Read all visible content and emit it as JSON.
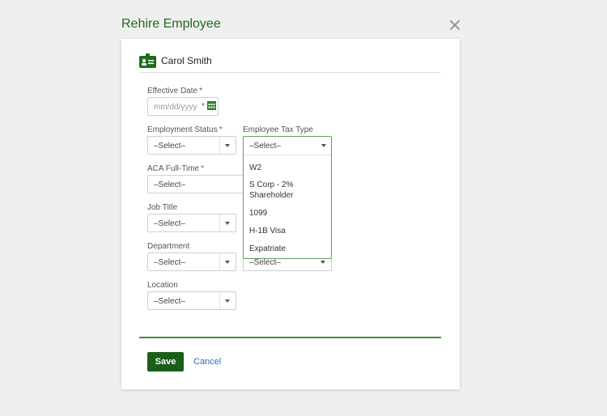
{
  "dialog": {
    "title": "Rehire Employee",
    "close_icon": "close-icon"
  },
  "employee": {
    "name": "Carol Smith",
    "icon": "id-badge-icon"
  },
  "form": {
    "required_mark": "*",
    "effective_date": {
      "label": "Effective Date",
      "placeholder": "mm/dd/yyyy",
      "icon": "calendar-icon"
    },
    "employment_status": {
      "label": "Employment Status",
      "value": "–Select–"
    },
    "employee_tax_type": {
      "label": "Employee Tax Type",
      "value": "–Select–",
      "options": [
        "W2",
        "S Corp - 2% Shareholder",
        "1099",
        "H-1B Visa",
        "Expatriate"
      ]
    },
    "aca_full_time": {
      "label": "ACA Full-Time",
      "value": "–Select–"
    },
    "job_title": {
      "label": "Job Title",
      "value": "–Select–"
    },
    "department": {
      "label": "Department",
      "value": "–Select–"
    },
    "hidden_select": {
      "value": "–Select–"
    },
    "location": {
      "label": "Location",
      "value": "–Select–"
    }
  },
  "actions": {
    "save_label": "Save",
    "cancel_label": "Cancel"
  },
  "colors": {
    "title": "#1f6b1f",
    "save_bg": "#1a5e1a",
    "divider": "#3f8f3f",
    "link": "#2c6fb0"
  }
}
